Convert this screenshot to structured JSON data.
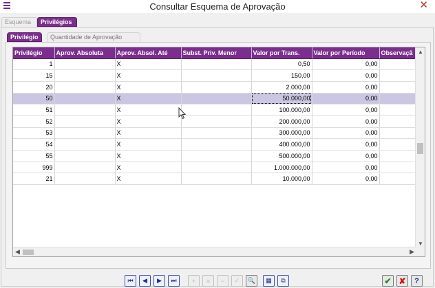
{
  "window": {
    "title": "Consultar Esquema de Aprovação"
  },
  "outer_tabs": [
    {
      "label": "Esquema"
    },
    {
      "label": "Privilégios"
    }
  ],
  "inner_tabs": [
    {
      "label": "Privilégio"
    },
    {
      "label": "Quantidade de Aprovação"
    }
  ],
  "grid": {
    "columns": [
      "Privilégio",
      "Aprov. Absoluta",
      "Aprov. Absol. Até",
      "Subst. Priv. Menor",
      "Valor por Trans.",
      "Valor por Período",
      "Observaçã"
    ],
    "rows": [
      [
        "1",
        "",
        "X",
        "",
        "0,50",
        "0,00",
        ""
      ],
      [
        "15",
        "",
        "X",
        "",
        "150,00",
        "0,00",
        ""
      ],
      [
        "20",
        "",
        "X",
        "",
        "2.000,00",
        "0,00",
        ""
      ],
      [
        "50",
        "",
        "X",
        "",
        "50.000,00",
        "0,00",
        ""
      ],
      [
        "51",
        "",
        "X",
        "",
        "100.000,00",
        "0,00",
        ""
      ],
      [
        "52",
        "",
        "X",
        "",
        "200.000,00",
        "0,00",
        ""
      ],
      [
        "53",
        "",
        "X",
        "",
        "300.000,00",
        "0,00",
        ""
      ],
      [
        "54",
        "",
        "X",
        "",
        "400.000,00",
        "0,00",
        ""
      ],
      [
        "55",
        "",
        "X",
        "",
        "500.000,00",
        "0,00",
        ""
      ],
      [
        "999",
        "",
        "X",
        "",
        "1.000.000,00",
        "0,00",
        ""
      ],
      [
        "21",
        "",
        "X",
        "",
        "10.000,00",
        "0,00",
        ""
      ]
    ],
    "selected_row": 3
  },
  "toolbar": {
    "nav_icons": [
      "first-record-icon",
      "previous-record-icon",
      "next-record-icon",
      "last-record-icon"
    ],
    "edit_icons": [
      "insert-icon",
      "edit-icon",
      "delete-icon",
      "post-icon"
    ],
    "other_icons": [
      "search-icon",
      "grid-view-icon",
      "export-icon"
    ],
    "actions": [
      "confirm-icon",
      "cancel-icon",
      "help-icon"
    ]
  },
  "colors": {
    "accent": "#7b2e8e",
    "selection": "#cbc6e2",
    "close": "#c42b1c"
  }
}
